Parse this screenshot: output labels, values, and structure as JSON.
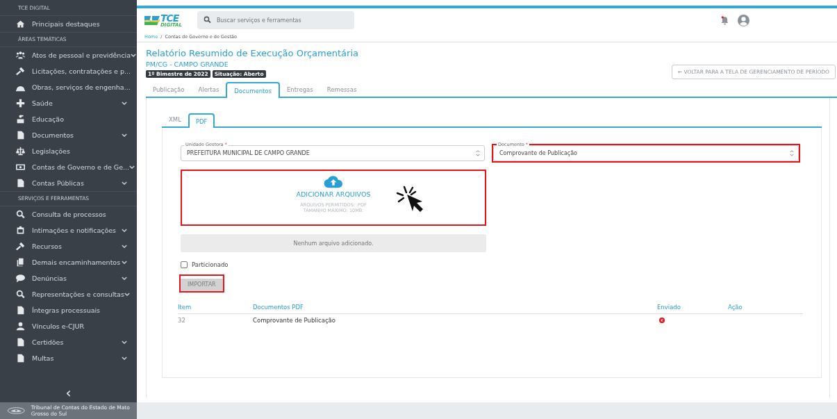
{
  "sidebar": {
    "sections": [
      {
        "title": "TCE DIGITAL",
        "items": [
          {
            "label": "Principais destaques",
            "kind": "home",
            "expandable": false
          }
        ]
      },
      {
        "title": "ÁREAS TEMÁTICAS",
        "items": [
          {
            "label": "Atos de pessoal e previdência",
            "kind": "users",
            "expandable": true
          },
          {
            "label": "Licitações, contratações e p...",
            "kind": "gavel",
            "expandable": false
          },
          {
            "label": "Obras, serviços de engenha...",
            "kind": "helmet",
            "expandable": false
          },
          {
            "label": "Saúde",
            "kind": "plus",
            "expandable": true
          },
          {
            "label": "Educação",
            "kind": "school",
            "expandable": false
          },
          {
            "label": "Documentos",
            "kind": "file",
            "expandable": true
          },
          {
            "label": "Legislações",
            "kind": "scale",
            "expandable": false
          },
          {
            "label": "Contas de Governo e de Ge...",
            "kind": "money",
            "expandable": true
          },
          {
            "label": "Contas Públicas",
            "kind": "file",
            "expandable": true
          }
        ]
      },
      {
        "title": "SERVIÇOS E FERRAMENTAS",
        "items": [
          {
            "label": "Consulta de processos",
            "kind": "search",
            "expandable": false
          },
          {
            "label": "Intimações e notificações",
            "kind": "notice",
            "expandable": true
          },
          {
            "label": "Recursos",
            "kind": "gavel",
            "expandable": true
          },
          {
            "label": "Demais encaminhamentos",
            "kind": "copy",
            "expandable": true
          },
          {
            "label": "Denúncias",
            "kind": "comment",
            "expandable": true
          },
          {
            "label": "Representações e consultas",
            "kind": "search",
            "expandable": true
          },
          {
            "label": "Íntegras processuais",
            "kind": "file",
            "expandable": false
          },
          {
            "label": "Vínculos e-CJUR",
            "kind": "user",
            "expandable": false
          },
          {
            "label": "Certidões",
            "kind": "file",
            "expandable": true
          },
          {
            "label": "Multas",
            "kind": "file",
            "expandable": true
          }
        ]
      }
    ],
    "collapse": "‹",
    "footer": "Tribunal de Contas do Estado de Mato Grosso do Sul"
  },
  "header": {
    "logo": {
      "main": "TCE",
      "sub": "DIGITAL"
    },
    "search": {
      "placeholder": "Buscar serviços e ferramentas"
    },
    "notifications_unread": true
  },
  "breadcrumb": {
    "separator": "/",
    "items": [
      "Home",
      "Contas de Governo e de Gestão"
    ]
  },
  "page": {
    "title": "Relatório Resumido de Execução Orçamentária",
    "subtitle": "PM/CG - CAMPO GRANDE",
    "badges": [
      "1º Bimestre de 2022",
      "Situação: Aberto"
    ],
    "back_button": "← VOLTAR PARA A TELA DE GERENCIAMENTO DE PERÍODO"
  },
  "tabs": [
    {
      "label": "Publicação",
      "selected": false
    },
    {
      "label": "Alertas",
      "selected": false
    },
    {
      "label": "Documentos",
      "selected": true
    },
    {
      "label": "Entregas",
      "selected": false
    },
    {
      "label": "Remessas",
      "selected": false
    }
  ],
  "subtabs": [
    {
      "label": "XML",
      "selected": false
    },
    {
      "label": "PDF",
      "selected": true
    }
  ],
  "form": {
    "unidade": {
      "label": "Unidade Gestora",
      "required_mark": "*",
      "value": "PREFEITURA MUNICIPAL DE CAMPO GRANDE",
      "highlighted": false
    },
    "documento": {
      "label": "Documento",
      "required_mark": "*",
      "value": "Comprovante de Publicação",
      "highlighted": true
    },
    "upload": {
      "title": "ADICIONAR ARQUIVOS",
      "allowed": "ARQUIVOS PERMITIDOS: .PDF",
      "max_size": "TAMANHO MÁXIMO: 10MB.",
      "highlighted": true
    },
    "empty_message": "Nenhum arquivo adicionado.",
    "partitioned": {
      "label": "Particionado",
      "checked": false
    },
    "import_button": {
      "label": "IMPORTAR",
      "disabled": true,
      "highlighted": true
    }
  },
  "table": {
    "columns": [
      "Item",
      "Documentos PDF",
      "Enviado",
      "Ação"
    ],
    "rows": [
      {
        "item": "32",
        "document": "Comprovante de Publicação",
        "sent": false
      }
    ]
  }
}
